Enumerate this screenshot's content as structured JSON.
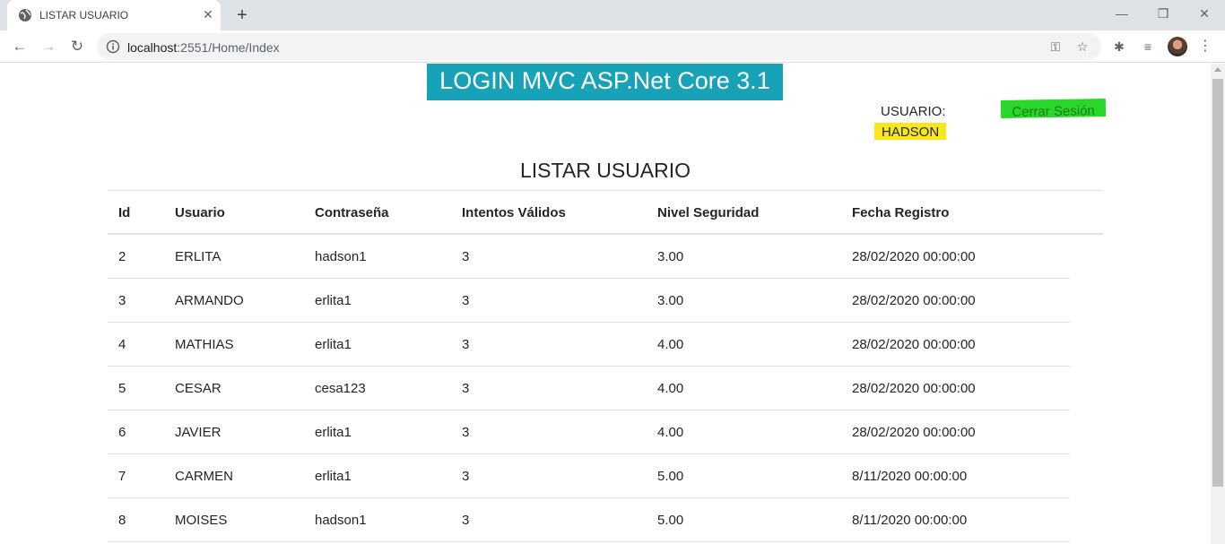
{
  "browser": {
    "tab_title": "LISTAR USUARIO",
    "url_host": "localhost",
    "url_path": ":2551/Home/Index"
  },
  "header": {
    "banner": "LOGIN MVC ASP.Net Core 3.1",
    "user_label": "USUARIO:",
    "user_name": "HADSON",
    "logout": "Cerrar Sesión",
    "colors": {
      "banner": "#17a2b8",
      "user_highlight": "#f8e71c",
      "logout_highlight": "#2ad62a"
    }
  },
  "main": {
    "title": "LISTAR USUARIO",
    "columns": [
      "Id",
      "Usuario",
      "Contraseña",
      "Intentos Válidos",
      "Nivel Seguridad",
      "Fecha Registro"
    ],
    "rows": [
      [
        "2",
        "ERLITA",
        "hadson1",
        "3",
        "3.00",
        "28/02/2020 00:00:00"
      ],
      [
        "3",
        "ARMANDO",
        "erlita1",
        "3",
        "3.00",
        "28/02/2020 00:00:00"
      ],
      [
        "4",
        "MATHIAS",
        "erlita1",
        "3",
        "4.00",
        "28/02/2020 00:00:00"
      ],
      [
        "5",
        "CESAR",
        "cesa123",
        "3",
        "4.00",
        "28/02/2020 00:00:00"
      ],
      [
        "6",
        "JAVIER",
        "erlita1",
        "3",
        "4.00",
        "28/02/2020 00:00:00"
      ],
      [
        "7",
        "CARMEN",
        "erlita1",
        "3",
        "5.00",
        "8/11/2020 00:00:00"
      ],
      [
        "8",
        "MOISES",
        "hadson1",
        "3",
        "5.00",
        "8/11/2020 00:00:00"
      ]
    ]
  }
}
